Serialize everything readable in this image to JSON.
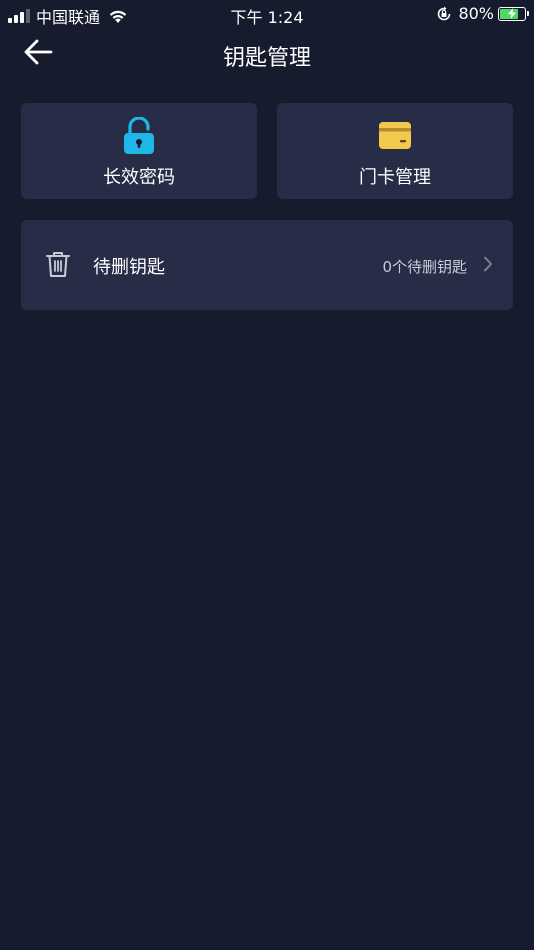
{
  "status_bar": {
    "carrier": "中国联通",
    "time": "下午 1:24",
    "battery_percent": "80%",
    "battery_level": 0.8,
    "icons": [
      "signal-icon",
      "wifi-icon",
      "orientation-lock-icon",
      "battery-charging-icon"
    ]
  },
  "nav": {
    "title": "钥匙管理",
    "back_icon": "back-arrow-icon"
  },
  "cards": [
    {
      "label": "长效密码",
      "icon": "unlock-icon",
      "icon_color": "#1fb6e8"
    },
    {
      "label": "门卡管理",
      "icon": "card-icon",
      "icon_color": "#f2c94c"
    }
  ],
  "pending": {
    "label": "待删钥匙",
    "count_text": "0个待删钥匙",
    "icon": "trash-icon",
    "chevron_icon": "chevron-right-icon"
  },
  "colors": {
    "background": "#171b2e",
    "card": "#272c47"
  }
}
